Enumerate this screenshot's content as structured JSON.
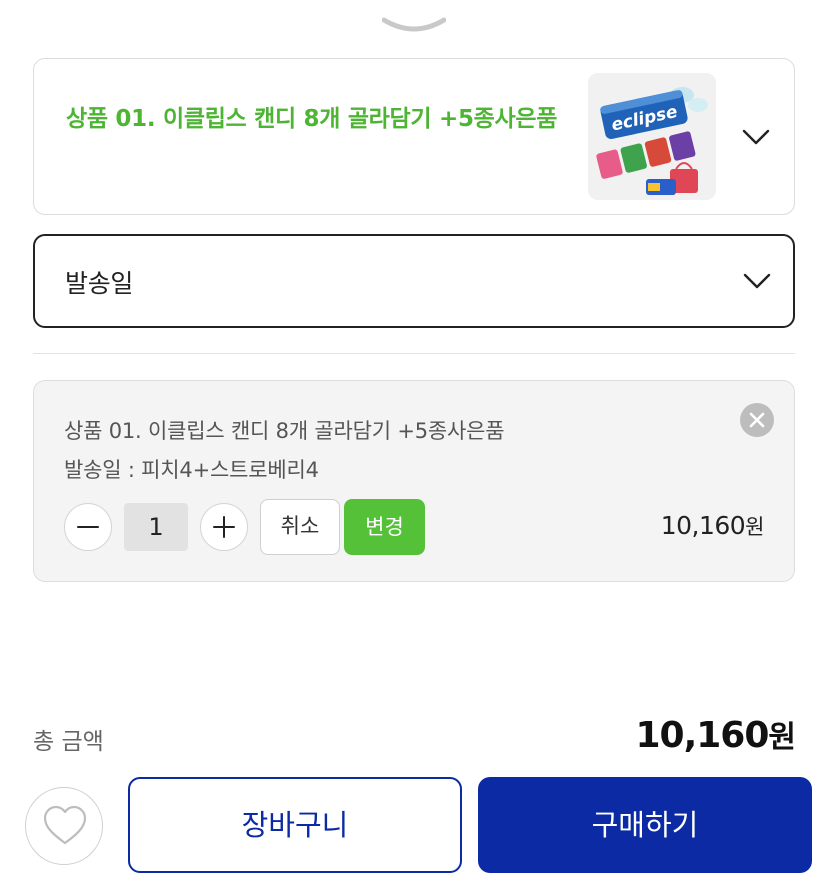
{
  "product": {
    "name": "상품 01. 이클립스 캔디 8개 골라담기 +5종사은품",
    "thumbnail_icon": "eclipse-candy-thumbnail",
    "thumbnail_brand_text": "eclipse"
  },
  "shipping": {
    "label": "발송일"
  },
  "selected_option": {
    "line1": "상품 01. 이클립스 캔디 8개 골라담기 +5종사은품",
    "line2": "발송일 : 피치4+스트로베리4",
    "quantity": "1",
    "cancel_label": "취소",
    "change_label": "변경",
    "price": "10,160",
    "currency": "원"
  },
  "summary": {
    "total_label": "총 금액",
    "total_price": "10,160",
    "currency": "원"
  },
  "actions": {
    "cart_label": "장바구니",
    "buy_label": "구매하기"
  },
  "colors": {
    "accent_green": "#4db533",
    "button_green": "#55c139",
    "primary_blue": "#0b2aa3"
  }
}
